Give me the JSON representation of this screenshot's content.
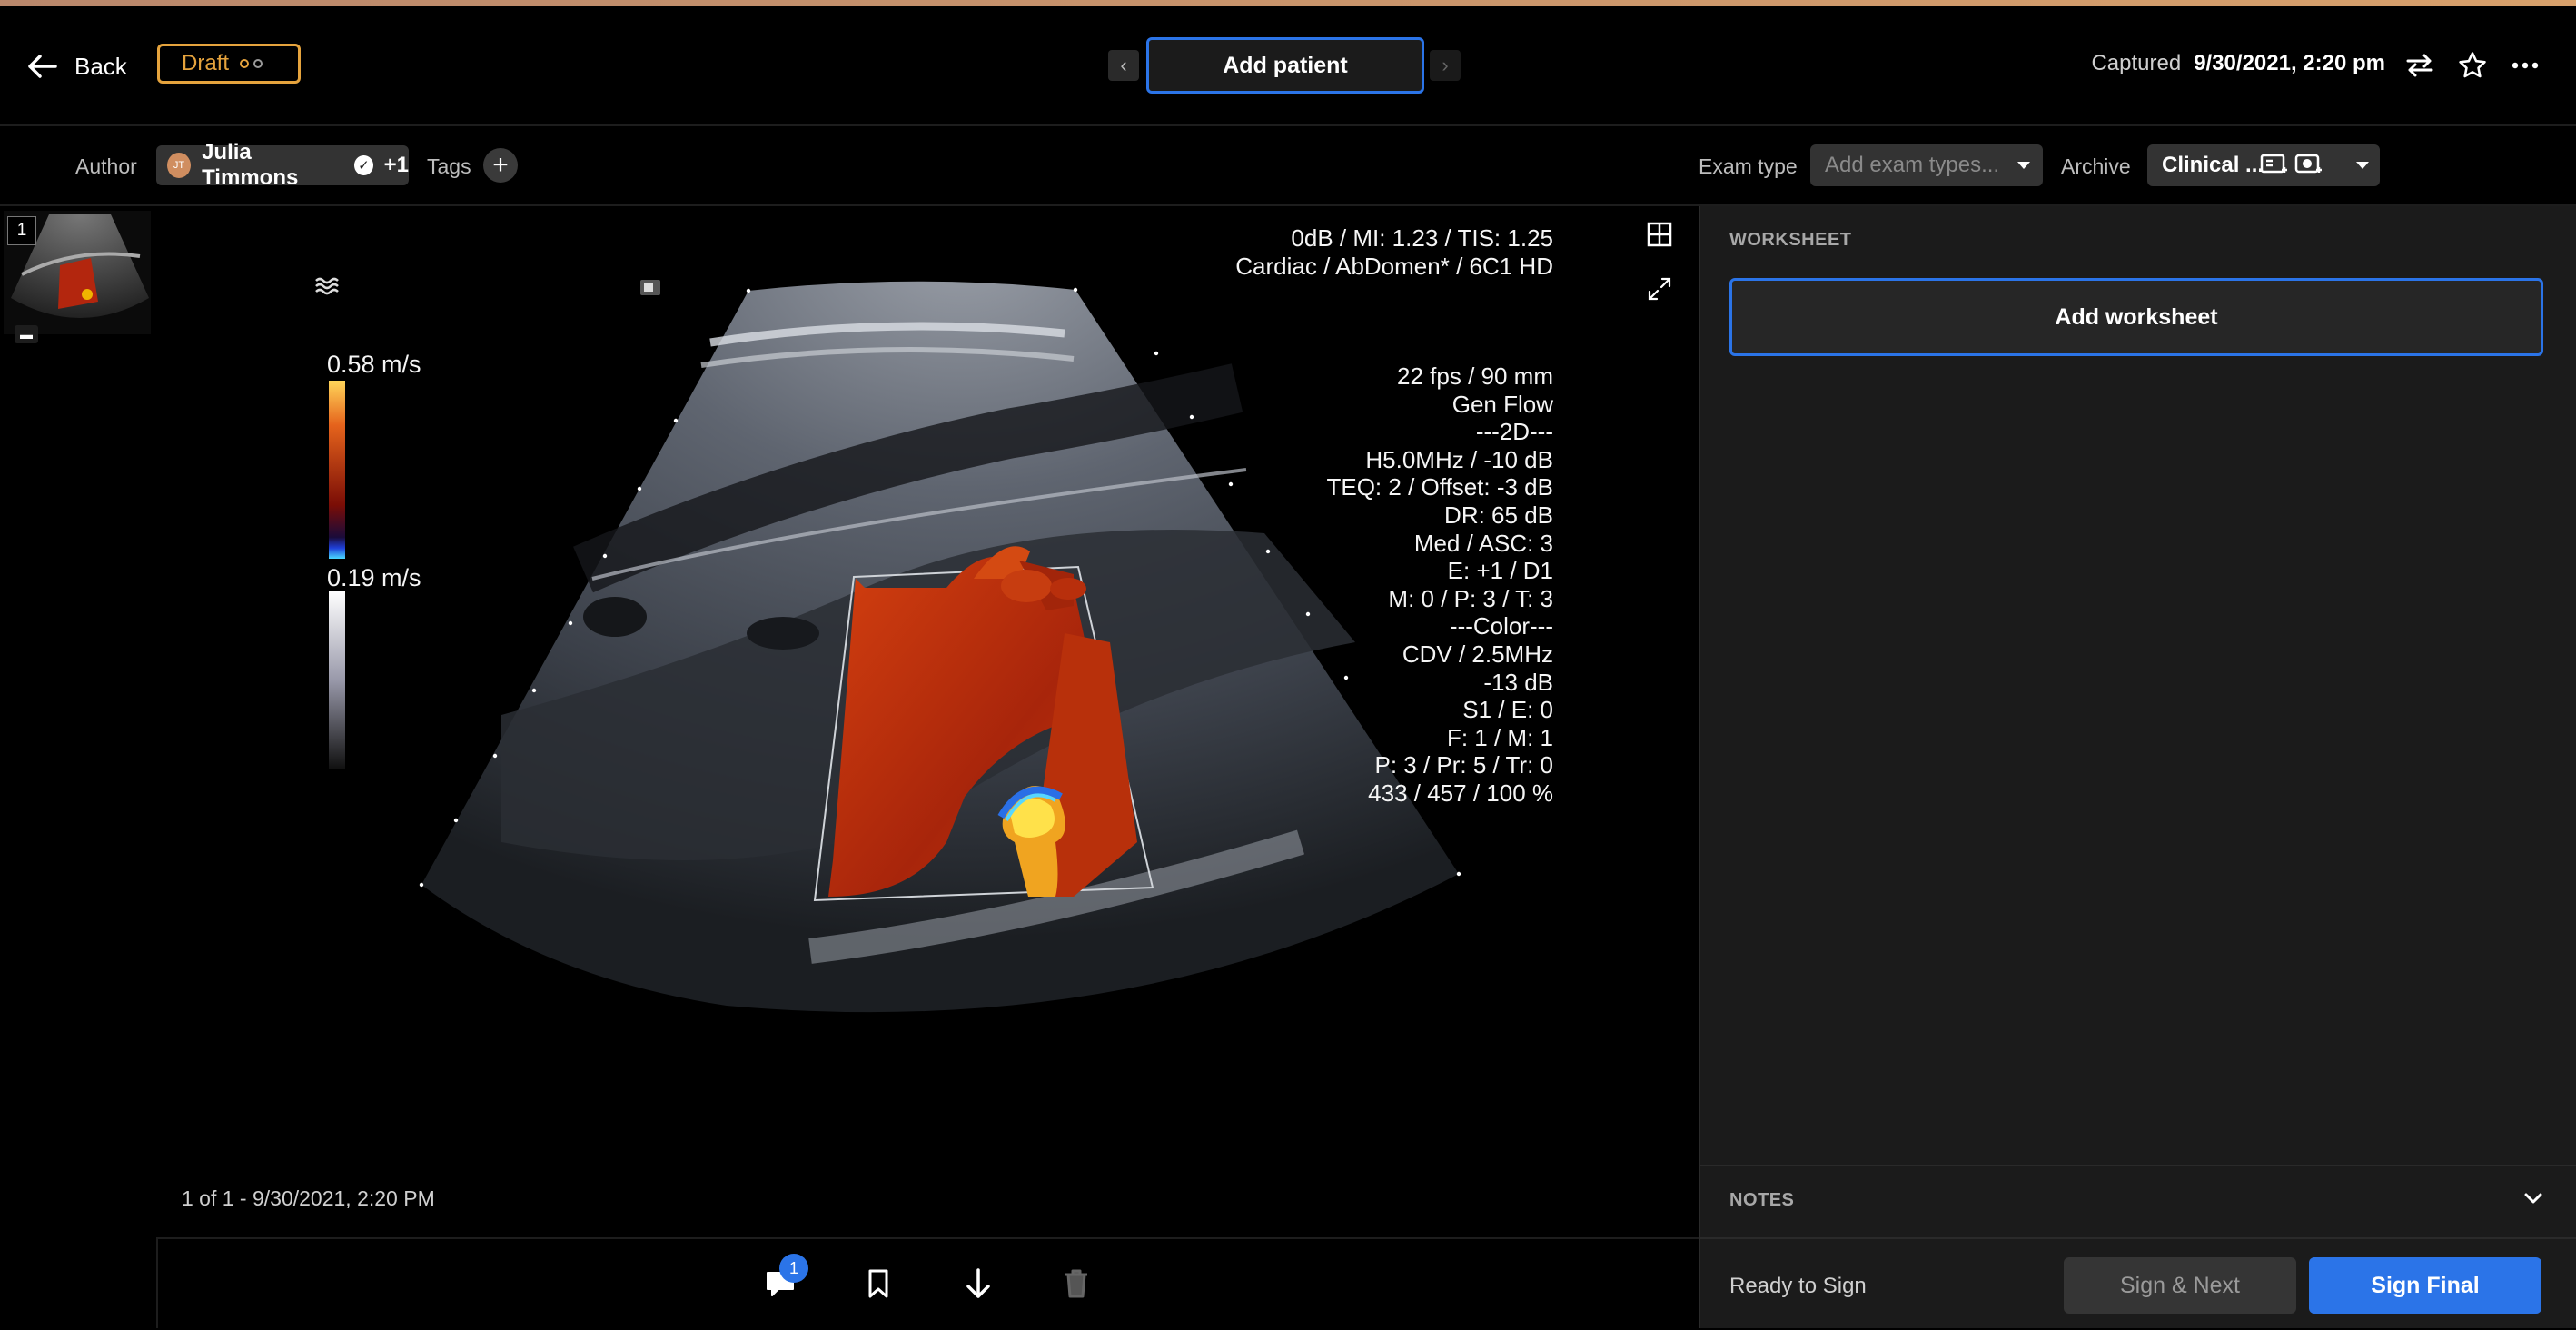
{
  "header": {
    "back_label": "Back",
    "status_badge": "Draft",
    "add_patient_label": "Add patient",
    "captured_label": "Captured",
    "captured_value": "9/30/2021, 2:20 pm"
  },
  "subbar": {
    "author_label": "Author",
    "author_initials": "JT",
    "author_name": "Julia Timmons",
    "author_extra": "+1",
    "tags_label": "Tags",
    "exam_type_label": "Exam type",
    "exam_type_placeholder": "Add exam types...",
    "archive_label": "Archive",
    "archive_value": "Clinical ..."
  },
  "thumbnail": {
    "number": "1"
  },
  "viewer": {
    "overlay_top": [
      "0dB / MI: 1.23 / TIS: 1.25",
      "Cardiac / AbDomen* / 6C1 HD"
    ],
    "overlay_params": [
      "22 fps / 90 mm",
      "Gen Flow",
      "---2D---",
      "H5.0MHz / -10 dB",
      "TEQ: 2 / Offset: -3 dB",
      "DR: 65 dB",
      "Med / ASC: 3",
      "E: +1 / D1",
      "M: 0 / P: 3 / T: 3",
      "---Color---",
      "CDV / 2.5MHz",
      "-13 dB",
      "S1 / E: 0",
      "F: 1 / M: 1",
      "P: 3 / Pr: 5 / Tr: 0",
      "433 / 457 / 100 %"
    ],
    "scale_top": "0.58 m/s",
    "scale_bottom": "0.19 m/s",
    "footer_caption": "1 of 1 - 9/30/2021, 2:20 PM"
  },
  "bottombar": {
    "comment_count": "1"
  },
  "worksheet": {
    "title": "WORKSHEET",
    "add_label": "Add worksheet"
  },
  "notes": {
    "title": "NOTES"
  },
  "signing": {
    "status": "Ready to Sign",
    "sign_next_label": "Sign & Next",
    "sign_final_label": "Sign Final"
  },
  "colors": {
    "accent_blue": "#2b74e8",
    "draft_orange": "#e5a33d",
    "panel_bg": "#1b1b1b"
  },
  "icons": [
    "arrow-left-icon",
    "chevron-left-icon",
    "chevron-right-icon",
    "swap-icon",
    "star-icon",
    "more-icon",
    "plus-icon",
    "grid-icon",
    "expand-icon",
    "comment-icon",
    "bookmark-icon",
    "download-icon",
    "trash-icon",
    "chevron-down-icon"
  ]
}
